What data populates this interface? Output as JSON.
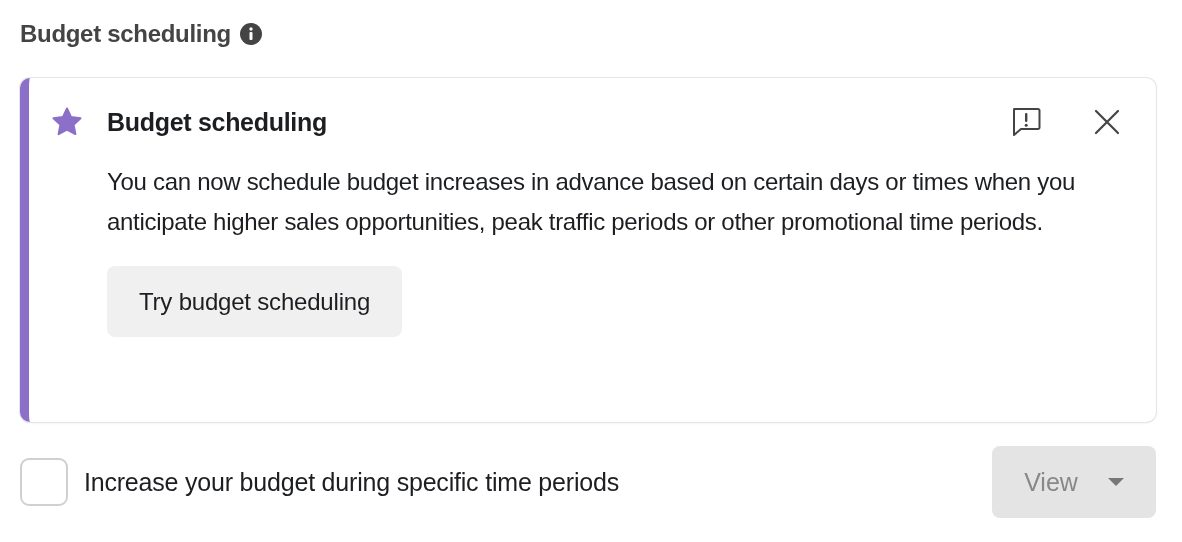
{
  "section": {
    "title": "Budget scheduling"
  },
  "notice": {
    "title": "Budget scheduling",
    "body": "You can now schedule budget increases in advance based on certain days or times when you anticipate higher sales opportunities, peak traffic periods or other promotional time periods.",
    "action": "Try budget scheduling"
  },
  "option": {
    "label": "Increase your budget during specific time periods",
    "checked": false
  },
  "view_button": {
    "label": "View",
    "disabled": true
  }
}
